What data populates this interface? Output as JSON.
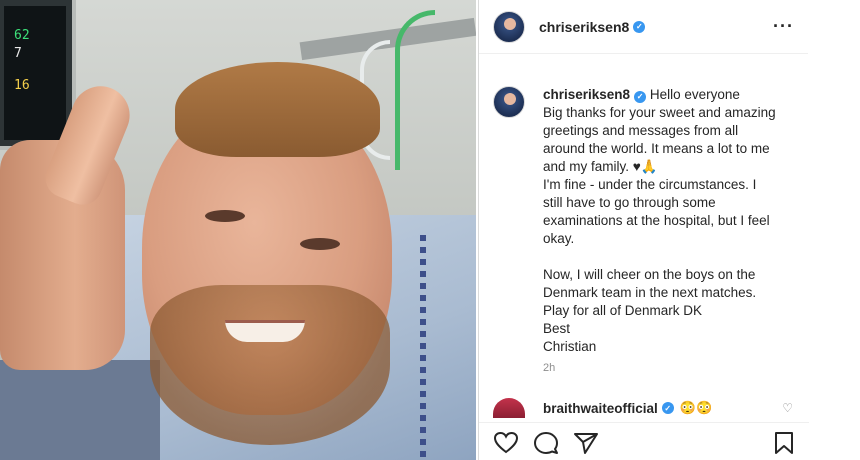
{
  "post": {
    "username": "chriseriksen8",
    "more_icon": "more-horizontal-icon"
  },
  "monitor": {
    "reading1": "62",
    "reading2": "7",
    "reading3": "16"
  },
  "caption": {
    "username": "chriseriksen8",
    "lines": [
      "Hello everyone",
      "Big thanks for your sweet and amazing",
      "greetings and messages from all",
      "around the world. It means a lot to me",
      "and my family. ♥🙏",
      "I'm fine - under the circumstances. I",
      "still have to go through some",
      "examinations at the hospital, but I feel",
      "okay.",
      "",
      "Now, I will cheer on the boys on the",
      "Denmark team in the next matches.",
      "Play for all of Denmark DK",
      "Best",
      "Christian"
    ],
    "time": "2h"
  },
  "comment": {
    "username": "braithwaiteofficial",
    "emoji": "😳😳"
  },
  "colors": {
    "verified": "#3897f0",
    "text": "#262626",
    "muted": "#8e8e8e"
  }
}
